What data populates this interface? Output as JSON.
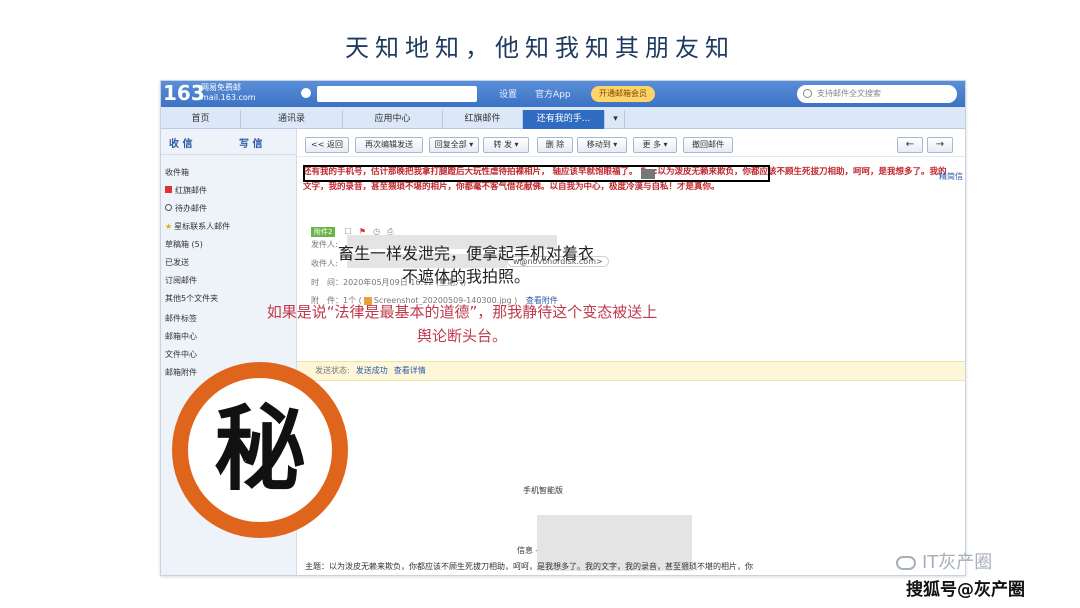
{
  "slide": {
    "title": "天知地知，他知我知其朋友知"
  },
  "mail": {
    "logo": "163",
    "logo_sub1": "网易免费邮",
    "logo_sub2": "mail.163.com",
    "top_links": [
      "设置",
      "官方App"
    ],
    "vip_label": "开通邮箱会员",
    "search_placeholder": "支持邮件全文搜索",
    "tabs": [
      "首页",
      "通讯录",
      "应用中心",
      "红旗邮件",
      "还有我的手..."
    ],
    "sidebar": {
      "receive": "收 信",
      "write": "写 信",
      "items": [
        "收件箱",
        "红旗邮件",
        "待办邮件",
        "星标联系人邮件",
        "草稿箱 (5)",
        "已发送",
        "订阅邮件",
        "其他5个文件夹",
        "邮件标签",
        "邮箱中心",
        "文件中心",
        "邮箱附件"
      ]
    },
    "toolbar": [
      "<< 返回",
      "再次编辑发送",
      "回复全部 ▾",
      "转 发 ▾",
      "删 除",
      "移动到 ▾",
      "更 多 ▾",
      "撤回邮件"
    ],
    "subject": "还有我的手机号，估计那晚把我拿打腿蹬后大玩性虐待拍裸相片，  轴应该早就饱眼福了。 Fw:以为泼皮无赖来欺负，你都应该不顾生死拔刀相助，呵呵，是我想多了。我的文字，我的录音，甚至猥琐不堪的相片，你都毫不客气借花献佛。以自我为中心，极度冷漠与自私！才是真你。",
    "thread_link": "精简信",
    "tag": "附件2",
    "sender_label": "发件人:",
    "recipient_label": "收件人:",
    "recipient_addr": "w@novonordisk.com>",
    "time_label": "时　间：",
    "time_value": "2020年05月09日 16:12 (星期六)",
    "attach_label": "附　件：",
    "attach_count": "1个 (",
    "attach_file": "Screenshot_20200509-140300.jpg )",
    "attach_view": "查看附件",
    "status_label": "发送状态:",
    "status_value": "发送成功",
    "status_detail": "查看详情",
    "body_fragment1": "手机智能版",
    "body_fragment2": "信息 --------",
    "body_line": "主题：以为泼皮无赖来欺负，你都应该不顾生死拔刀相助，呵呵，是我想多了。我的文字，我的录音，甚至猥琐不堪的相片，你"
  },
  "captions": {
    "line1": "畜生一样发泄完，便拿起手机对着衣不遮体的我拍照。",
    "line2": "如果是说“法律是最基本的道德”，那我静待这个变态被送上舆论断头台。"
  },
  "seal": {
    "char": "秘"
  },
  "watermark": {
    "wechat": "IT灰产圈",
    "sohu": "搜狐号@灰产圈"
  }
}
